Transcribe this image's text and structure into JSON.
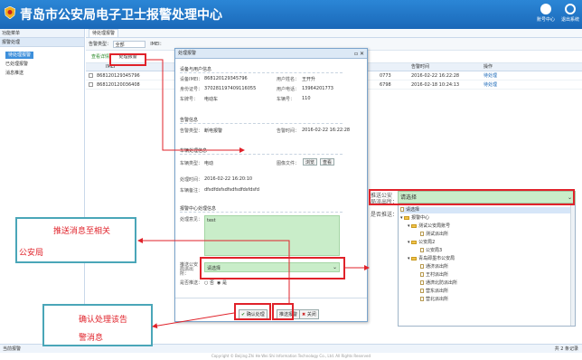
{
  "header": {
    "title": "青岛市公安局电子卫士报警处理中心",
    "btn_user": "账号中心",
    "btn_exit": "退出系统"
  },
  "sidebar": {
    "head": "功能菜单",
    "section": "报警处理",
    "items": [
      "待处理报警",
      "已处理报警",
      "消息推送"
    ]
  },
  "main": {
    "tab": "待处理报警",
    "filter_label1": "告警类型：",
    "filter_value1": "全部",
    "filter_label2": "IMEI：",
    "tool_view": "查看详情",
    "tool_process": "处理报警",
    "columns": {
      "imei": "IMEI",
      "time": "告警时间",
      "op": "操作"
    },
    "rows": [
      {
        "imei": "868120129345796",
        "code": "0773",
        "time": "2016-02-22 16:22:28",
        "op": "待处理"
      },
      {
        "imei": "868120120036408",
        "code": "6798",
        "time": "2016-02-18 10:24:13",
        "op": "待处理"
      }
    ]
  },
  "statusbar": {
    "left": "当前报警",
    "right": "共 2 条记录"
  },
  "footer": "Copyright © Beijing Zhi He Wei Shi Information Technology Co., Ltd. All Rights Reserved",
  "dialog": {
    "title": "处理报警",
    "sec_device": "设备与用户信息",
    "imei_label": "设备IMEI：",
    "imei_value": "868120129345796",
    "name_label": "用户姓名：",
    "name_value": "王开升",
    "id_label": "身份证号：",
    "id_value": "370281197409116055",
    "phone_label": "用户电话：",
    "phone_value": "13964201773",
    "carrier_label": "车牌号：",
    "carrier_value": "电动车",
    "code_label": "车辆号：",
    "code_value": "110",
    "sec_alarm": "告警信息",
    "atype_label": "告警类型：",
    "atype_value": "断电报警",
    "atime_label": "告警时间：",
    "atime_value": "2016-02-22 16:22:28",
    "sec_handle": "车辆处理信息",
    "htype_label": "车辆类型：",
    "htype_value": "电动",
    "file_label": "图像文件：",
    "upload_btn": "浏览",
    "view_btn": "查看",
    "htime_label": "处理时间：",
    "htime_value": "2016-02-22 16:20:10",
    "note_label": "车辆备注：",
    "note_value": "dfsdfdsfsdfsdfsdfdsfdsfd",
    "sec_center": "报警中心处理信息",
    "opinion_label": "处理意见：",
    "opinion_value": "test",
    "push_label": "推送公安局派出所：",
    "push_value": "请选择",
    "done_label": "是否推送：",
    "radio_no": "否",
    "radio_yes": "是",
    "confirm_btn": "确认处理",
    "push_btn": "推送报警",
    "close_btn": "关闭"
  },
  "dropdown": {
    "label1": "推送公安",
    "label2": "局派出所：",
    "label3": "是否推送：",
    "selected": "请选择",
    "options": [
      "请选择",
      "报警中心",
      "测试公安局账号",
      "测试派出所",
      "公安局2",
      "公安局3",
      "青岛即墨市公安局",
      "通济派出所",
      "王村派出所",
      "通濟北防派出所",
      "营东派出所",
      "营北派出所"
    ]
  },
  "annotations": {
    "push_note": "推送消息至相关",
    "push_note2": "公安局",
    "confirm_note": "确认处理该告",
    "confirm_note2": "警消息"
  },
  "colors": {
    "accent": "#1a68b8",
    "annotation": "#e0222a",
    "callout": "#4aa6b8",
    "field": "#c9edc9"
  }
}
